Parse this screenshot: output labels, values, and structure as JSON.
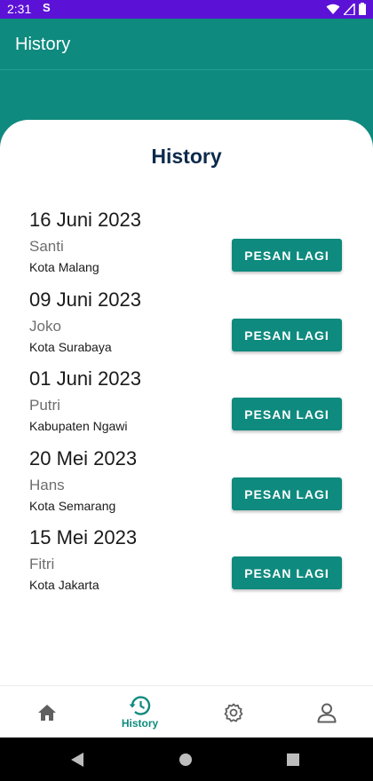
{
  "status_bar": {
    "time": "2:31",
    "sync_glyph": "S"
  },
  "app_bar": {
    "title": "History"
  },
  "card": {
    "title": "History"
  },
  "history": [
    {
      "date": "16 Juni 2023",
      "name": "Santi",
      "city": "Kota Malang",
      "button": "PESAN LAGI"
    },
    {
      "date": "09 Juni 2023",
      "name": "Joko",
      "city": "Kota Surabaya",
      "button": "PESAN LAGI"
    },
    {
      "date": "01 Juni 2023",
      "name": "Putri",
      "city": "Kabupaten Ngawi",
      "button": "PESAN LAGI"
    },
    {
      "date": "20 Mei 2023",
      "name": "Hans",
      "city": "Kota Semarang",
      "button": "PESAN LAGI"
    },
    {
      "date": "15 Mei 2023",
      "name": "Fitri",
      "city": "Kota Jakarta",
      "button": "PESAN LAGI"
    }
  ],
  "bottom_nav": {
    "items": [
      {
        "icon": "home-icon"
      },
      {
        "icon": "history-icon",
        "label": "History",
        "active": true
      },
      {
        "icon": "settings-icon"
      },
      {
        "icon": "profile-icon"
      }
    ]
  },
  "colors": {
    "primary": "#0e8a7e",
    "status_bar": "#5b12d6",
    "title_text": "#0d2a4b"
  }
}
